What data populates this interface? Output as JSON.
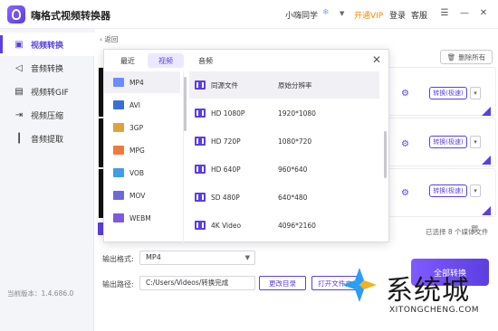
{
  "app": {
    "title": "嗨格式视频转换器",
    "user": "小嗨同学",
    "vip": "开通VIP",
    "login": "登录",
    "service": "客服"
  },
  "sidebar": {
    "items": [
      {
        "label": "视频转换",
        "icon": "video-convert-icon"
      },
      {
        "label": "音频转换",
        "icon": "speaker-icon"
      },
      {
        "label": "视频转GIF",
        "icon": "gif-icon"
      },
      {
        "label": "视频压缩",
        "icon": "compress-icon"
      },
      {
        "label": "音频提取",
        "icon": "waveform-icon"
      }
    ],
    "version": "当前版本：1.4.686.0"
  },
  "main": {
    "back": "返回",
    "delete_all": "删除所有",
    "convert_label": "转换(极速)",
    "selected": "已选择 8 个媒体文件",
    "output_format_label": "输出格式:",
    "output_format": "MP4",
    "output_path_label": "输出路径:",
    "output_path": "C:/Users/Videos/转换完成",
    "change_dir": "更改目录",
    "open_folder": "打开文件夹",
    "convert_all": "全部转换"
  },
  "panel": {
    "tabs": [
      "最近",
      "视频",
      "音频"
    ],
    "formats": [
      "MP4",
      "AVI",
      "3GP",
      "MPG",
      "VOB",
      "MOV",
      "WEBM"
    ],
    "format_colors": [
      "#6a8cff",
      "#3b6fd6",
      "#e0a23a",
      "#ee7b3c",
      "#3f9ee6",
      "#6a6ad6",
      "#7a5cdc"
    ],
    "resolutions": [
      {
        "name": "同源文件",
        "value": "原始分辨率"
      },
      {
        "name": "HD 1080P",
        "value": "1920*1080"
      },
      {
        "name": "HD 720P",
        "value": "1080*720"
      },
      {
        "name": "HD 640P",
        "value": "960*640"
      },
      {
        "name": "SD 480P",
        "value": "640*480"
      },
      {
        "name": "4K Video",
        "value": "4096*2160"
      }
    ]
  },
  "watermark": {
    "text": "系统城",
    "sub": "XITONGCHENG.COM"
  }
}
